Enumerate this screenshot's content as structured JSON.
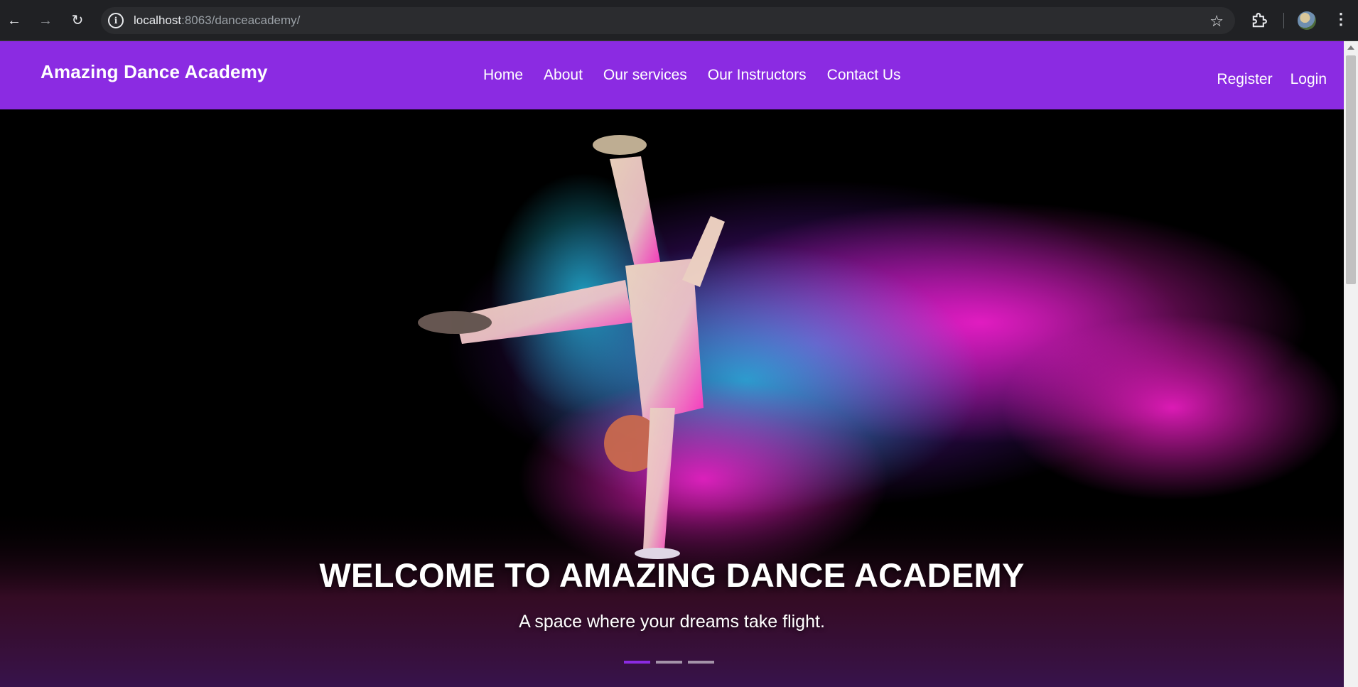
{
  "browser": {
    "back_icon": "arrow-left",
    "forward_icon": "arrow-right",
    "reload_icon": "reload",
    "url_host": "localhost",
    "url_rest": ":8063/danceacademy/",
    "star_icon": "star",
    "extensions_icon": "puzzle",
    "menu_icon": "kebab"
  },
  "header": {
    "brand": "Amazing Dance Academy",
    "nav": {
      "home": "Home",
      "about": "About",
      "services": "Our services",
      "instructors": "Our Instructors",
      "contact": "Contact Us"
    },
    "auth": {
      "register": "Register",
      "login": "Login"
    },
    "background_color": "#8b2be2"
  },
  "hero": {
    "title": "WELCOME TO AMAZING DANCE ACADEMY",
    "subtitle": "A space where your dreams take flight.",
    "slides_total": 3,
    "active_slide": 1,
    "accent_colors": [
      "#ff1fd2",
      "#1ec8e6",
      "#8b2be2"
    ]
  }
}
